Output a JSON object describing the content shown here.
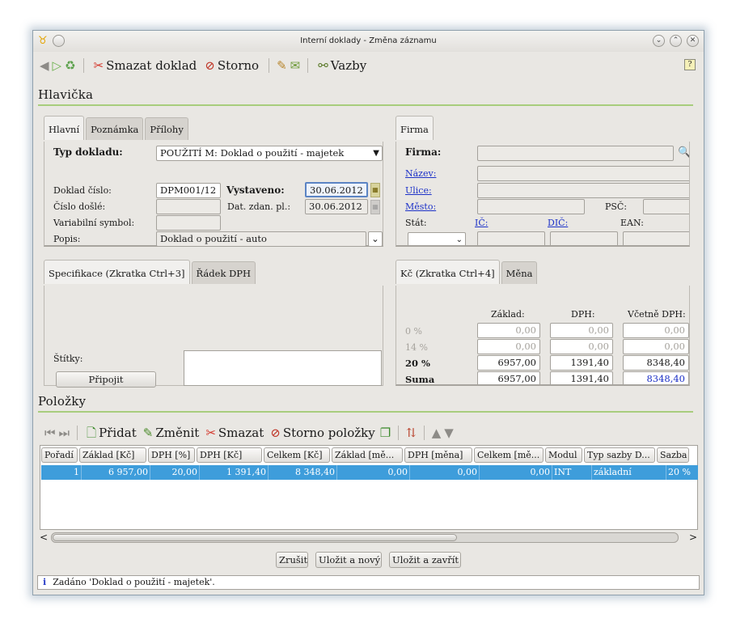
{
  "window": {
    "title": "Interní doklady - Změna záznamu"
  },
  "toolbar": {
    "delete_label": "Smazat doklad",
    "cancel_label": "Storno",
    "links_label": "Vazby"
  },
  "header": {
    "section_title": "Hlavička",
    "left_tabs": [
      "Hlavní",
      "Poznámka",
      "Přílohy"
    ],
    "right_tabs": [
      "Firma"
    ],
    "typ_dokladu_label": "Typ dokladu:",
    "typ_dokladu_value": "POUŽITÍ M: Doklad o použití - majetek",
    "doklad_cislo_label": "Doklad číslo:",
    "doklad_cislo_value": "DPM001/12",
    "vystaveno_label": "Vystaveno:",
    "vystaveno_value": "30.06.2012",
    "cislo_dosle_label": "Číslo došlé:",
    "dat_zdan_label": "Dat. zdan. pl.:",
    "dat_zdan_value": "30.06.2012",
    "variabilni_label": "Variabilní symbol:",
    "popis_label": "Popis:",
    "popis_value": "Doklad o použití - auto",
    "firma_label": "Firma:",
    "nazev_label": "Název:",
    "ulice_label": "Ulice:",
    "mesto_label": "Město:",
    "psc_label": "PSČ:",
    "stat_label": "Stát:",
    "ic_label": "IČ:",
    "dic_label": "DIČ:",
    "ean_label": "EAN:"
  },
  "spec": {
    "left_tabs": [
      "Specifikace (Zkratka Ctrl+3]",
      "Řádek DPH"
    ],
    "right_tabs": [
      "Kč (Zkratka Ctrl+4]",
      "Měna"
    ],
    "stitky_label": "Štítky:",
    "pripojit_label": "Připojit",
    "col_zaklad": "Základ:",
    "col_dph": "DPH:",
    "col_vcetne": "Včetně DPH:",
    "rows": [
      {
        "label": "0 %",
        "zaklad": "0,00",
        "dph": "0,00",
        "vcetne": "0,00"
      },
      {
        "label": "14 %",
        "zaklad": "0,00",
        "dph": "0,00",
        "vcetne": "0,00"
      },
      {
        "label": "20 %",
        "zaklad": "6957,00",
        "dph": "1391,40",
        "vcetne": "8348,40"
      },
      {
        "label": "Suma",
        "zaklad": "6957,00",
        "dph": "1391,40",
        "vcetne": "8348,40"
      }
    ]
  },
  "items": {
    "section_title": "Položky",
    "add_label": "Přidat",
    "edit_label": "Změnit",
    "delete_label": "Smazat",
    "cancel_label": "Storno položky",
    "columns": [
      "Pořadí",
      "Základ [Kč]",
      "DPH [%]",
      "DPH [Kč]",
      "Celkem [Kč]",
      "Základ [mě...",
      "DPH [měna]",
      "Celkem [mě...",
      "Modul",
      "Typ sazby D...",
      "Sazba"
    ],
    "rows": [
      [
        "1",
        "6 957,00",
        "20,00",
        "1 391,40",
        "8 348,40",
        "0,00",
        "0,00",
        "0,00",
        "INT",
        "základní",
        "20 %"
      ]
    ]
  },
  "footer": {
    "zrusit_label": "Zrušit",
    "ulozit_novy_label": "Uložit a nový",
    "ulozit_zavrit_label": "Uložit a zavřít",
    "status_text": "Zadáno 'Doklad o použití - majetek'.",
    "status_icon": "i"
  }
}
